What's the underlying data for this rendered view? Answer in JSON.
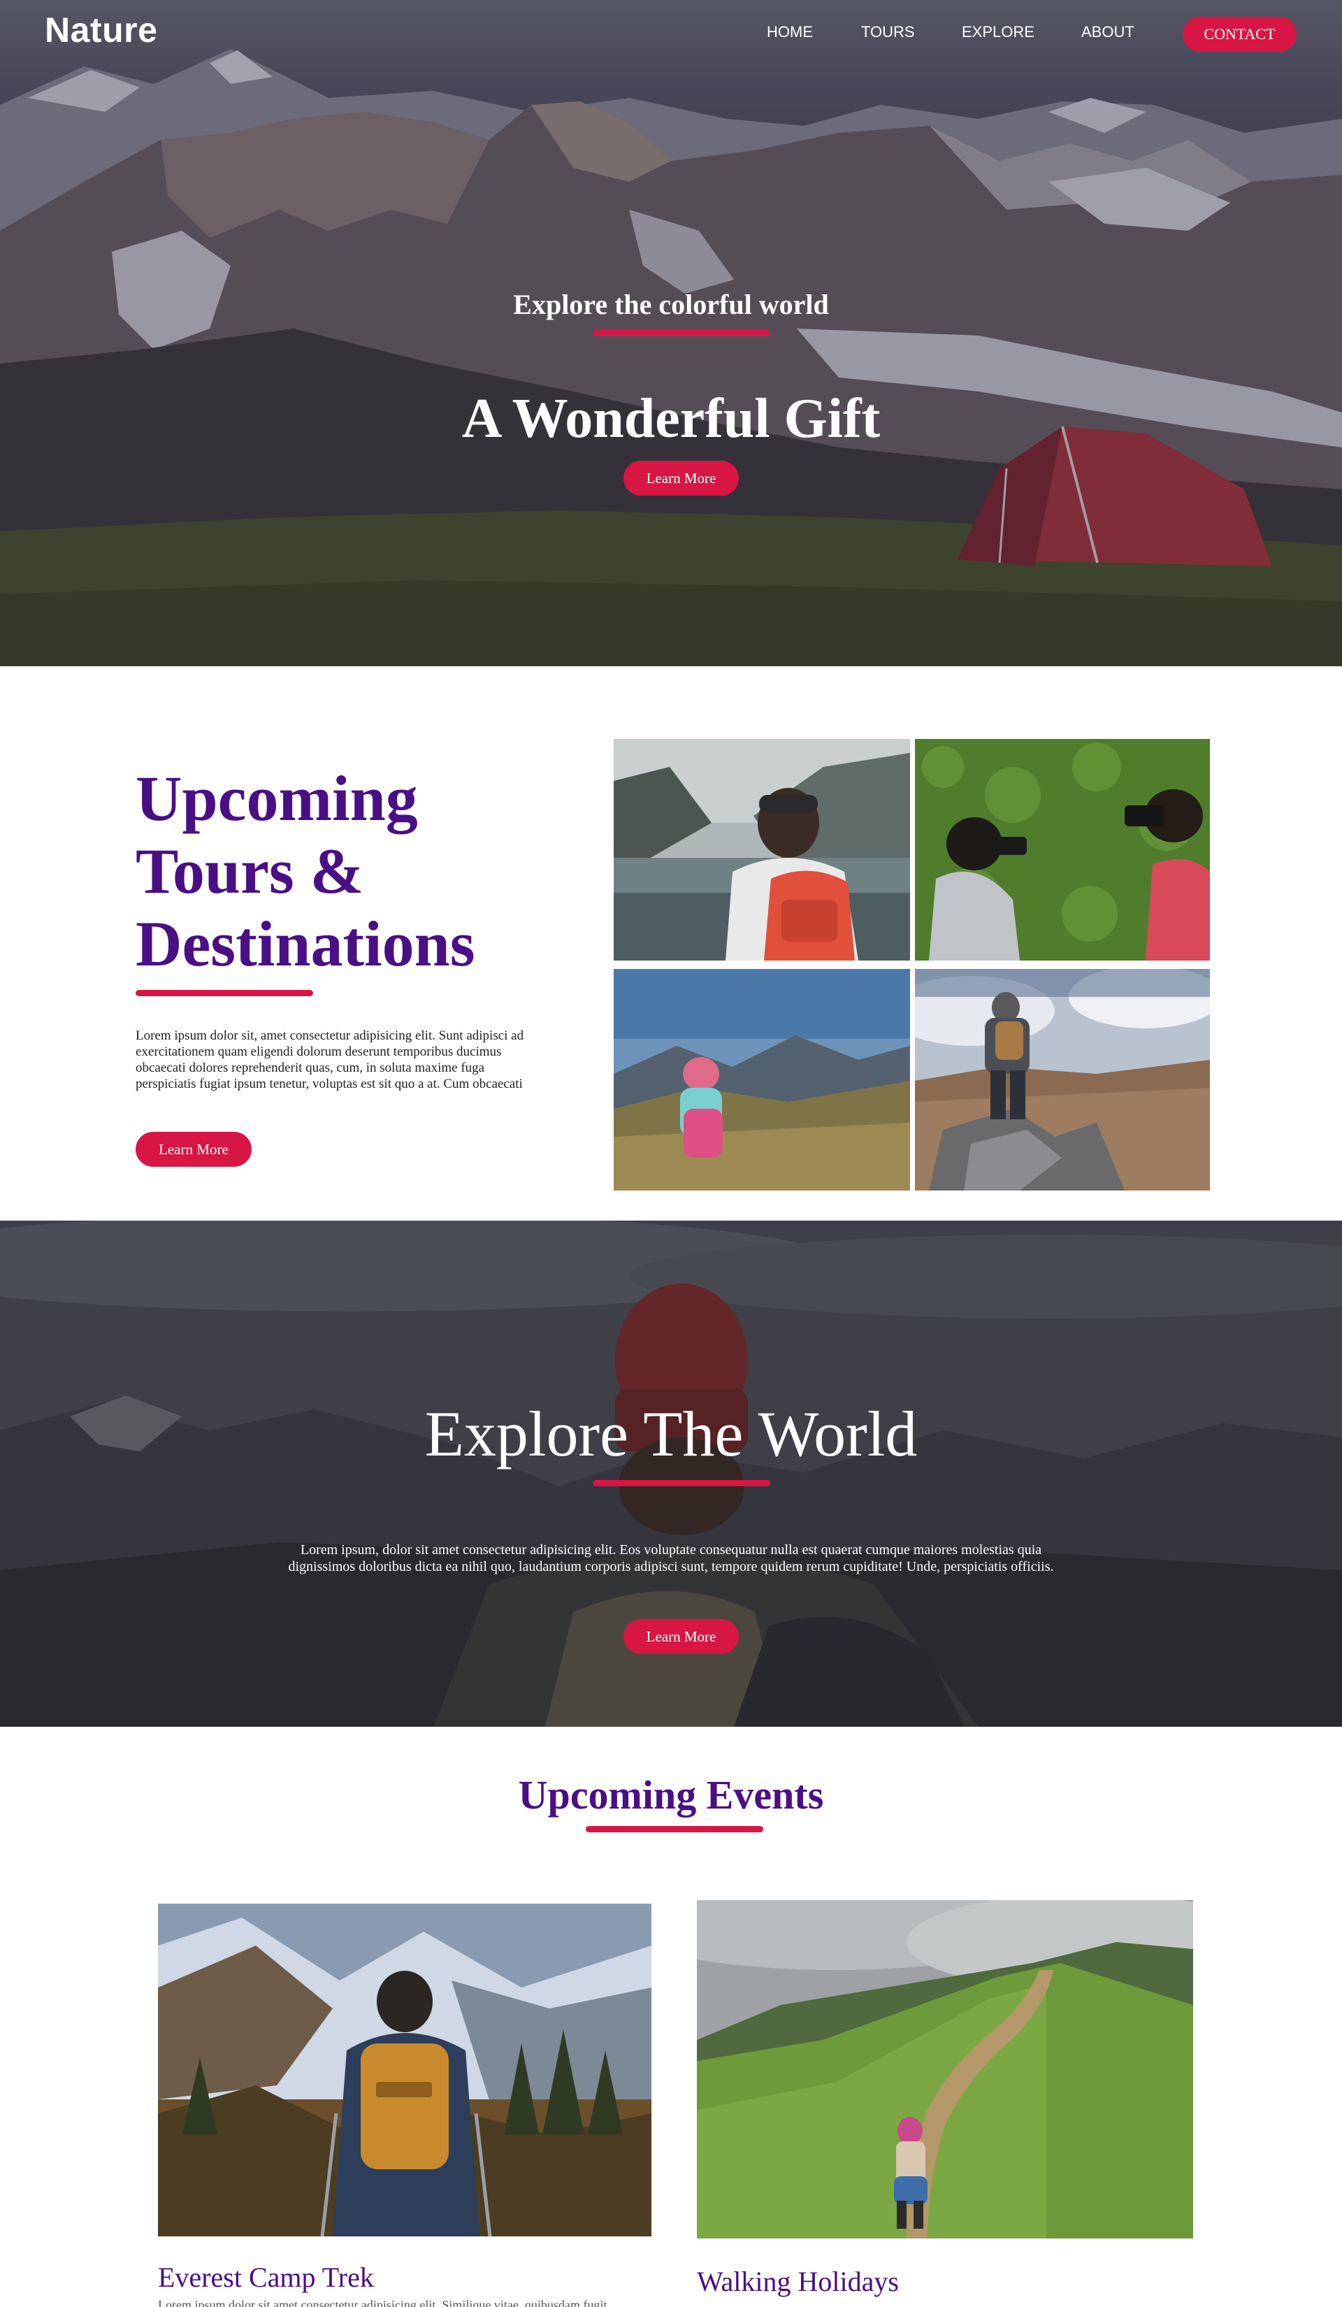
{
  "nav": {
    "logo": "Nature",
    "links": [
      "HOME",
      "TOURS",
      "EXPLORE",
      "ABOUT"
    ],
    "contact_label": "CONTACT"
  },
  "hero": {
    "subtitle": "Explore the colorful world",
    "title": "A Wonderful Gift",
    "button_label": "Learn More"
  },
  "tours": {
    "title_lines": [
      "Upcoming",
      "Tours &",
      "Destinations"
    ],
    "text": "Lorem ipsum dolor sit, amet consectetur adipisicing elit. Sunt adipisci ad exercitationem quam eligendi dolorum deserunt temporibus ducimus obcaecati dolores reprehenderit quas, cum, in soluta maxime fuga perspiciatis fugiat ipsum tenetur, voluptas est sit quo a at. Cum obcaecati",
    "button_label": "Learn More"
  },
  "explore": {
    "title": "Explore The World",
    "text": "Lorem ipsum, dolor sit amet consectetur adipisicing elit. Eos voluptate consequatur nulla est quaerat cumque maiores molestias quia dignissimos doloribus dicta ea nihil quo, laudantium corporis adipisci sunt, tempore quidem rerum cupiditate! Unde, perspiciatis officiis.",
    "button_label": "Learn More"
  },
  "events": {
    "title": "Upcoming Events",
    "items": [
      {
        "name": "Everest Camp Trek",
        "desc": "Lorem ipsum dolor sit amet consectetur adipisicing elit. Similique vitae, quibusdam fugit"
      },
      {
        "name": "Walking Holidays",
        "desc": ""
      }
    ]
  },
  "colors": {
    "accent": "#d81643",
    "heading": "#4a0e85"
  }
}
